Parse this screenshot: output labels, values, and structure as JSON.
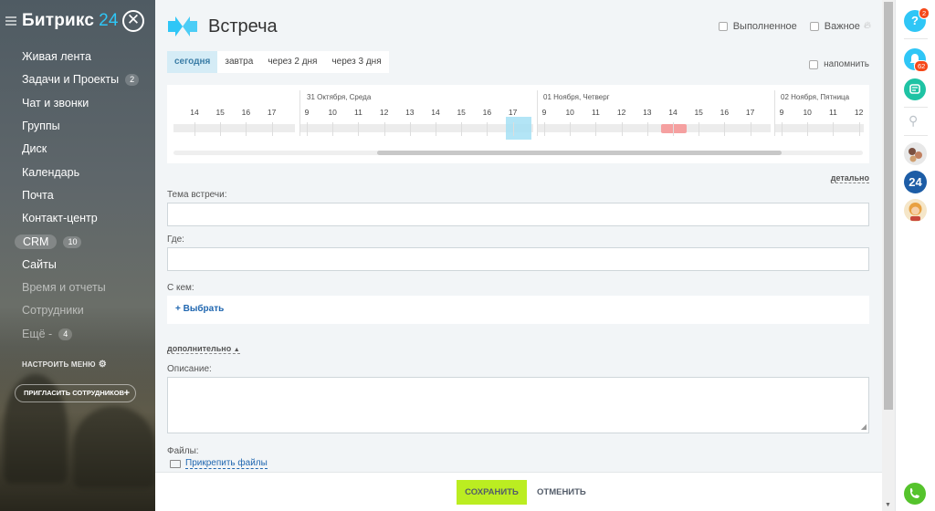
{
  "sidebar": {
    "logo_text": "Битрикс",
    "logo_number": "24",
    "close_symbol": "✕",
    "items": [
      {
        "label": "Живая лента",
        "badge": ""
      },
      {
        "label": "Задачи и Проекты",
        "badge": "2"
      },
      {
        "label": "Чат и звонки",
        "badge": ""
      },
      {
        "label": "Группы",
        "badge": ""
      },
      {
        "label": "Диск",
        "badge": ""
      },
      {
        "label": "Календарь",
        "badge": ""
      },
      {
        "label": "Почта",
        "badge": ""
      },
      {
        "label": "Контакт-центр",
        "badge": ""
      },
      {
        "label": "CRM",
        "badge": "10"
      },
      {
        "label": "Сайты",
        "badge": ""
      },
      {
        "label": "Время и отчеты",
        "badge": ""
      },
      {
        "label": "Сотрудники",
        "badge": ""
      },
      {
        "label": "Ещё -",
        "badge": "4"
      }
    ],
    "configure_label": "НАСТРОИТЬ МЕНЮ",
    "invite_label": "ПРИГЛАСИТЬ СОТРУДНИКОВ"
  },
  "header": {
    "title": "Встреча",
    "done_label": "Выполненное",
    "important_label": "Важное"
  },
  "tabs": [
    "сегодня",
    "завтра",
    "через 2 дня",
    "через 3 дня"
  ],
  "active_tab": 0,
  "remind_label": "напомнить",
  "timeline": {
    "days": [
      "31 Октября, Среда",
      "01 Ноября, Четверг",
      "02 Ноября, Пятница"
    ],
    "prev_hours": [
      "14",
      "15",
      "16",
      "17"
    ],
    "day_hours": [
      "9",
      "10",
      "11",
      "12",
      "13",
      "14",
      "15",
      "16",
      "17"
    ],
    "last_hours": [
      "9",
      "10",
      "11",
      "12"
    ]
  },
  "detail_link": "детально",
  "form": {
    "topic_label": "Тема встречи:",
    "topic_value": "",
    "where_label": "Где:",
    "where_value": "",
    "with_label": "С кем:",
    "choose_label": "+ Выбрать",
    "more_label": "дополнительно",
    "description_label": "Описание:",
    "description_value": "",
    "files_label": "Файлы:",
    "attach_label": "Прикрепить файлы"
  },
  "footer": {
    "save_label": "СОХРАНИТЬ",
    "cancel_label": "ОТМЕНИТЬ"
  },
  "rightbar": {
    "help_count": "2",
    "notify_count": "62",
    "bitrix_badge": "24"
  },
  "colors": {
    "accent": "#2fc6f6",
    "save": "#bbed21",
    "link": "#2067b0",
    "counter": "#f54819",
    "busy": "#f5a0a0",
    "now": "#a6e0f5"
  }
}
